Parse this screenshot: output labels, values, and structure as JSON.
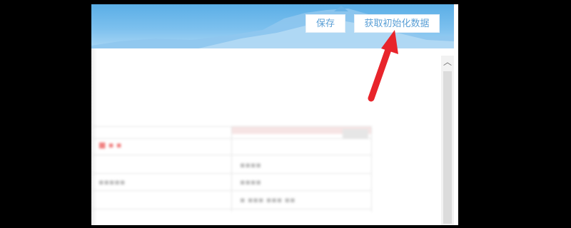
{
  "header": {
    "save_label": "保存",
    "init_label": "获取初始化数据"
  },
  "scrollbar": {
    "up_glyph": "︿"
  },
  "table": {
    "row1_label": "■ ▪ ▪",
    "row2_label": "▪▪▪▪▪",
    "row2_value": "▪▪▪▪",
    "row3_value": "▪▪▪▪",
    "row4_value": "▪  ▪▪▪ ▪▪▪ ▪▪"
  },
  "colors": {
    "header_blue": "#5aaee6",
    "button_text": "#5a9fd6",
    "arrow_red": "#e8242b"
  }
}
